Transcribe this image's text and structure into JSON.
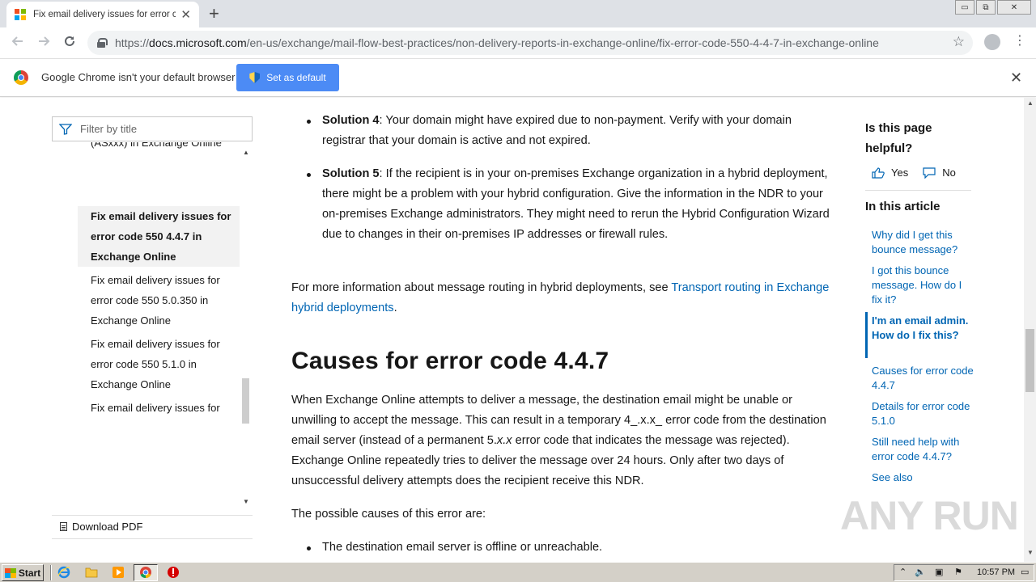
{
  "browser": {
    "tab_title": "Fix email delivery issues for error co",
    "tab_close": "✕",
    "new_tab": "+",
    "url_scheme": "https://",
    "url_host": "docs.microsoft.com",
    "url_path": "/en-us/exchange/mail-flow-best-practices/non-delivery-reports-in-exchange-online/fix-error-code-550-4-4-7-in-exchange-online",
    "infobar_text": "Google Chrome isn't your default browser",
    "set_default_label": "Set as default",
    "window_controls": [
      "▭",
      "⧉",
      "✕"
    ]
  },
  "sidebar": {
    "filter_placeholder": "Filter by title",
    "cut_item": "(ASxxx) in Exchange Online",
    "items": [
      {
        "label": "Fix email delivery issues for error code 550 4.4.7 in Exchange Online",
        "lines": [
          "Fix email delivery issues for",
          "error code 550 4.4.7 in",
          "Exchange Online"
        ],
        "active": true
      },
      {
        "label": "Fix email delivery issues for error code 550 5.0.350 in Exchange Online",
        "lines": [
          "Fix email delivery issues for",
          "error code 550 5.0.350 in",
          "Exchange Online"
        ],
        "active": false
      },
      {
        "label": "Fix email delivery issues for error code 550 5.1.0 in Exchange Online",
        "lines": [
          "Fix email delivery issues for",
          "error code 550 5.1.0 in",
          "Exchange Online"
        ],
        "active": false
      },
      {
        "label": "Fix email delivery issues for",
        "lines": [
          "Fix email delivery issues for"
        ],
        "active": false
      }
    ],
    "download_pdf": "Download PDF"
  },
  "article": {
    "solution4_label": "Solution 4",
    "solution4_text": ": Your domain might have expired due to non-payment. Verify with your domain registrar that your domain is active and not expired.",
    "solution5_label": "Solution 5",
    "solution5_text": ": If the recipient is in your on-premises Exchange organization in a hybrid deployment, there might be a problem with your hybrid configuration. Give the information in the NDR to your on-premises Exchange administrators. They might need to rerun the Hybrid Configuration Wizard due to changes in their on-premises IP addresses or firewall rules.",
    "more_info_text": "For more information about message routing in hybrid deployments, see ",
    "more_info_link": "Transport routing in Exchange hybrid deployments",
    "more_info_end": ".",
    "heading": "Causes for error code 4.4.7",
    "para1_a": "When Exchange Online attempts to deliver a message, the destination email might be unable or unwilling to accept the message. This can result in a temporary 4_.x.x_ error code from the destination email server (instead of a permanent 5.",
    "para1_b": "x.x",
    "para1_c": " error code that indicates the message was rejected). Exchange Online repeatedly tries to deliver the message over 24 hours. Only after two days of unsuccessful delivery attempts does the recipient receive this NDR.",
    "para2": "The possible causes of this error are:",
    "bullet1": "The destination email server is offline or unreachable."
  },
  "aside": {
    "helpful_title": "Is this page helpful?",
    "yes": "Yes",
    "no": "No",
    "in_article": "In this article",
    "links": [
      {
        "label": "Why did I get this bounce message?",
        "current": false
      },
      {
        "label": "I got this bounce message. How do I fix it?",
        "current": false
      },
      {
        "label": "I'm an email admin. How do I fix this?",
        "current": true
      },
      {
        "label": "Causes for error code 4.4.7",
        "current": false
      },
      {
        "label": "Details for error code 5.1.0",
        "current": false
      },
      {
        "label": "Still need help with error code 4.4.7?",
        "current": false
      },
      {
        "label": "See also",
        "current": false
      }
    ]
  },
  "watermark": "ANY RUN",
  "taskbar": {
    "start_label": "Start",
    "time": "10:57 PM"
  },
  "colors": {
    "accent": "#0065b3",
    "button_blue": "#4c8bf5",
    "taskbar": "#d4d0c8"
  }
}
